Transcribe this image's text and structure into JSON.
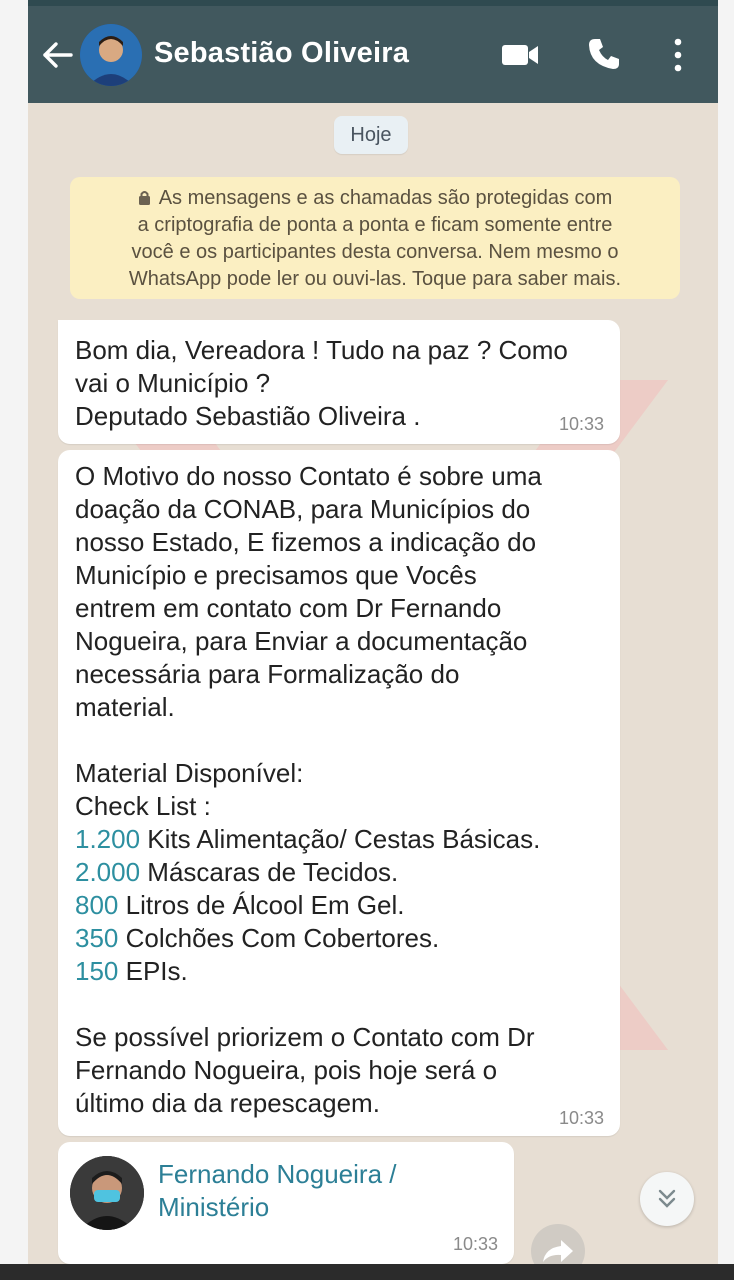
{
  "header": {
    "contact_name": "Sebastião Oliveira"
  },
  "chat": {
    "date_label": "Hoje",
    "encryption_notice_lines": [
      "As mensagens e as chamadas são protegidas com",
      "a criptografia de ponta a ponta e ficam somente entre",
      "você e os participantes desta conversa. Nem mesmo o",
      "WhatsApp pode ler ou ouvi-las. Toque para saber mais."
    ],
    "messages": [
      {
        "lines": [
          "Bom dia, Vereadora ! Tudo na paz ? Como",
          "vai o Município ?",
          "Deputado Sebastião Oliveira ."
        ],
        "time": "10:33"
      },
      {
        "paragraph_lines": [
          "O Motivo do nosso Contato é sobre uma",
          "doação da CONAB, para Municípios do",
          "nosso Estado, E fizemos a indicação do",
          "Município e precisamos que Vocês",
          "entrem em contato com Dr Fernando",
          "Nogueira, para Enviar a documentação",
          "necessária para Formalização do",
          "material."
        ],
        "material_heading": "Material Disponível:",
        "checklist_heading": "Check List :",
        "items": [
          {
            "qty": "1.200",
            "desc": " Kits Alimentação/ Cestas Básicas."
          },
          {
            "qty": "2.000",
            "desc": " Máscaras de Tecidos."
          },
          {
            "qty": "800",
            "desc": " Litros de Álcool Em Gel."
          },
          {
            "qty": "350",
            "desc": " Colchões Com Cobertores."
          },
          {
            "qty": "150",
            "desc": " EPIs."
          }
        ],
        "closing_lines": [
          "Se possível priorizem o Contato com Dr",
          "Fernando Nogueira, pois hoje será o",
          "último dia da repescagem."
        ],
        "time": "10:33"
      },
      {
        "contact_card_lines": [
          "Fernando Nogueira /",
          "Ministério"
        ],
        "time": "10:33"
      }
    ]
  },
  "icons": {
    "back": "arrow-left-icon",
    "video": "video-camera-icon",
    "call": "phone-icon",
    "menu": "vertical-dots-icon",
    "scroll_down": "double-chevron-down-icon",
    "forward": "forward-arrow-icon",
    "lock": "lock-icon"
  },
  "colors": {
    "header_bg": "#41585e",
    "chat_bg": "#e7ded3",
    "notice_bg": "#fbefc2",
    "link_blue": "#2c7f96",
    "number_blue": "#2d8fa0"
  }
}
